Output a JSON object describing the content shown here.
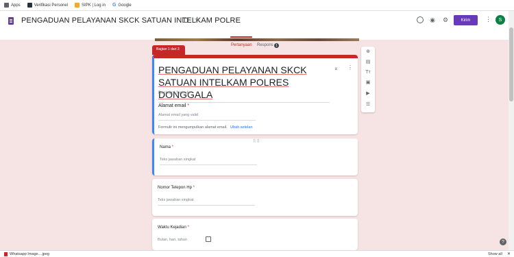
{
  "bookmarks": [
    {
      "label": "Apps",
      "color": "#5f6368"
    },
    {
      "label": "Verifikasi Personel",
      "color": "#263238"
    },
    {
      "label": "SIPK | Log in",
      "color": "#f9a825"
    },
    {
      "label": "Google",
      "icon": "G",
      "color": "#4285f4"
    }
  ],
  "header": {
    "title": "PENGADUAN PELAYANAN SKCK SATUAN INTELKAM POLRE",
    "send_label": "Kirim",
    "avatar_letter": "S"
  },
  "tabs": {
    "questions": "Pertanyaan",
    "responses": "Respons",
    "responses_count": "1"
  },
  "section_label": "Bagian 1 dari 3",
  "form": {
    "title": "PENGADUAN PELAYANAN SKCK SATUAN INTELKAM POLRES DONGGALA",
    "description_placeholder": "Deskripsi formulir",
    "email_label": "Alamat email",
    "email_placeholder": "Alamat email yang valid",
    "email_note": "Formulir ini mengumpulkan alamat email.",
    "email_link": "Ubah setelan",
    "required_mark": "*"
  },
  "questions": [
    {
      "label": "Nama",
      "placeholder": "Teks jawaban singkat"
    },
    {
      "label": "Nomor Telepon Hp",
      "placeholder": "Teks jawaban singkat"
    },
    {
      "label": "Waktu Kejadian",
      "placeholder": "Bulan, hari, tahun"
    }
  ],
  "downloads": {
    "file_name": "Whatsapp Image....jpeg",
    "show_all": "Show all"
  },
  "colors": {
    "accent": "#c62828",
    "brand": "#673ab7",
    "focus": "#4285f4",
    "background": "#f6e3e3"
  }
}
